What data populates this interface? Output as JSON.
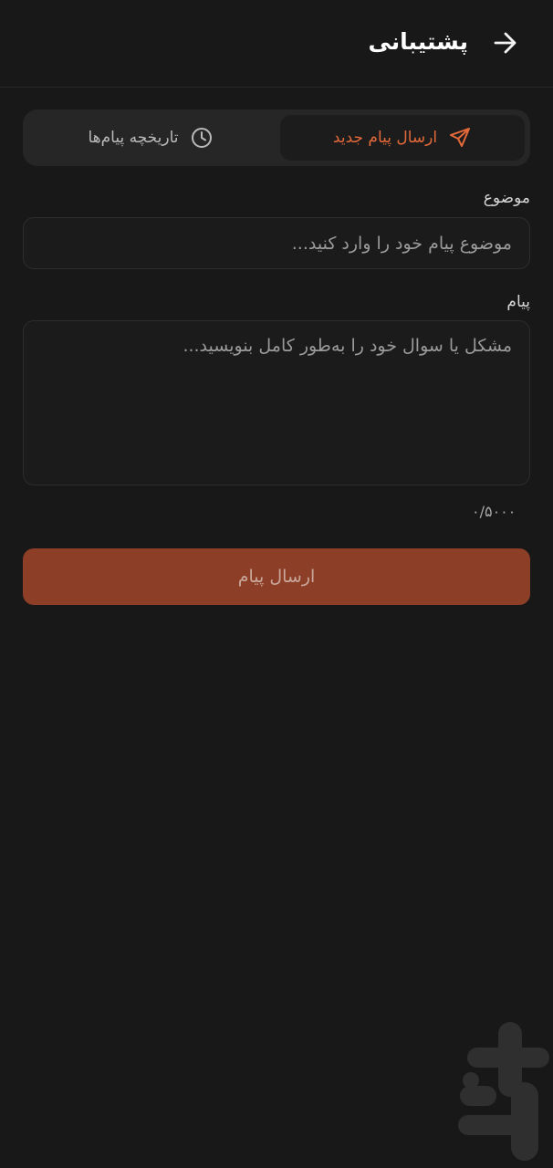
{
  "header": {
    "title": "پشتیبانی",
    "back_icon": "arrow-right-icon"
  },
  "tabs": [
    {
      "label": "ارسال پیام جدید",
      "icon": "send-icon",
      "active": true
    },
    {
      "label": "تاریخچه پیام‌ها",
      "icon": "clock-icon",
      "active": false
    }
  ],
  "form": {
    "subject": {
      "label": "موضوع",
      "value": "",
      "placeholder": "موضوع پیام خود را وارد کنید..."
    },
    "message": {
      "label": "پیام",
      "value": "",
      "placeholder": "مشکل یا سوال خود را به‌طور کامل بنویسید..."
    },
    "char_counter": "۰/۵۰۰۰",
    "submit_label": "ارسال پیام"
  },
  "colors": {
    "background": "#181818",
    "accent": "#e4693a",
    "submit_bg": "#8c3e27"
  }
}
